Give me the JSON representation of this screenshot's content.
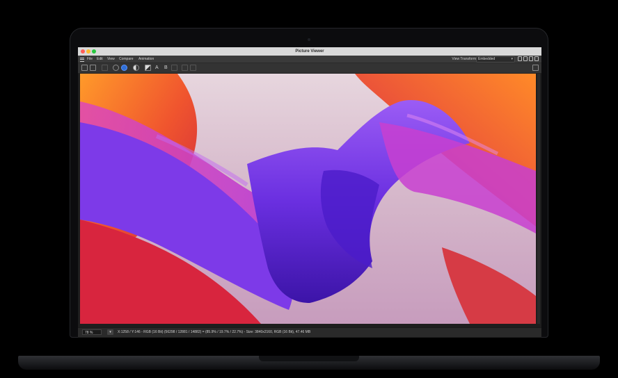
{
  "window": {
    "title": "Picture Viewer"
  },
  "menu": {
    "items": [
      "File",
      "Edit",
      "View",
      "Compare",
      "Animation"
    ]
  },
  "view_transform": {
    "label": "View Transform",
    "value": "Embedded"
  },
  "toolbar": {
    "text_a": "A",
    "text_b": "B"
  },
  "status": {
    "zoom": "78 %",
    "info": "X:1258 / Y:146 - RGB (16 Bit) (56298 / 12881 / 14882) = (85.9% / 19.7% / 22.7%) - Size: 3840x2160, RGB (16 Bit), 47.46 MB"
  },
  "colors": {
    "accent": "#2f6fd6",
    "red": "#ff5f57",
    "yellow": "#febc2e",
    "green": "#28c840"
  }
}
